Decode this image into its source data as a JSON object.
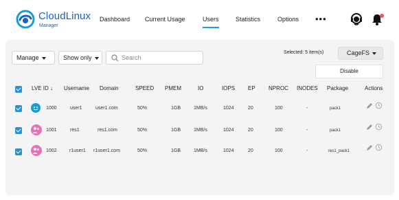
{
  "brand": {
    "name": "CloudLinux",
    "subtitle": "Manager",
    "accent": "#1f5fbf"
  },
  "nav": {
    "items": [
      {
        "label": "Dashboard",
        "active": false
      },
      {
        "label": "Current Usage",
        "active": false
      },
      {
        "label": "Users",
        "active": true
      },
      {
        "label": "Statistics",
        "active": false
      },
      {
        "label": "Options",
        "active": false
      }
    ],
    "more": "•••"
  },
  "header_icons": [
    "support-icon",
    "bell-icon"
  ],
  "toolbar": {
    "manage": "Manage",
    "show_only": "Show only",
    "search_placeholder": "Search",
    "search_value": "",
    "selected_text": "Selected: 5 item(s)",
    "cagefs": "CageFS",
    "disable": "Disable"
  },
  "table": {
    "columns": [
      "LVE ID ↓",
      "Username",
      "Domain",
      "SPEED",
      "PMEM",
      "IO",
      "IOPS",
      "EP",
      "NPROC",
      "INODES",
      "Package",
      "Actions"
    ],
    "rows": [
      {
        "lve_id": "1000",
        "username": "user1",
        "domain": "user1.com",
        "speed": "50%",
        "pmem": "1GB",
        "io": "1MB/s",
        "iops": "1024",
        "ep": "20",
        "nproc": "100",
        "inodes": "-",
        "package": "pack1",
        "avatar": "blue",
        "checked": true
      },
      {
        "lve_id": "1001",
        "username": "res1",
        "domain": "res1.com",
        "speed": "50%",
        "pmem": "1GB",
        "io": "1MB/s",
        "iops": "1024",
        "ep": "20",
        "nproc": "100",
        "inodes": "-",
        "package": "pack1",
        "avatar": "pink",
        "checked": true
      },
      {
        "lve_id": "1002",
        "username": "r1user1",
        "domain": "r1user1.com",
        "speed": "50%",
        "pmem": "1GB",
        "io": "1MB/s",
        "iops": "1024",
        "ep": "20",
        "nproc": "100",
        "inodes": "-",
        "package": "res1_pack1",
        "avatar": "pink",
        "checked": true
      }
    ]
  },
  "colors": {
    "checkbox": "#2d8fd5",
    "active_tab": "#1a9cd8",
    "notification": "#e8565a",
    "avatar_blue": "#1a9cd8",
    "avatar_pink": "#e573b8"
  }
}
